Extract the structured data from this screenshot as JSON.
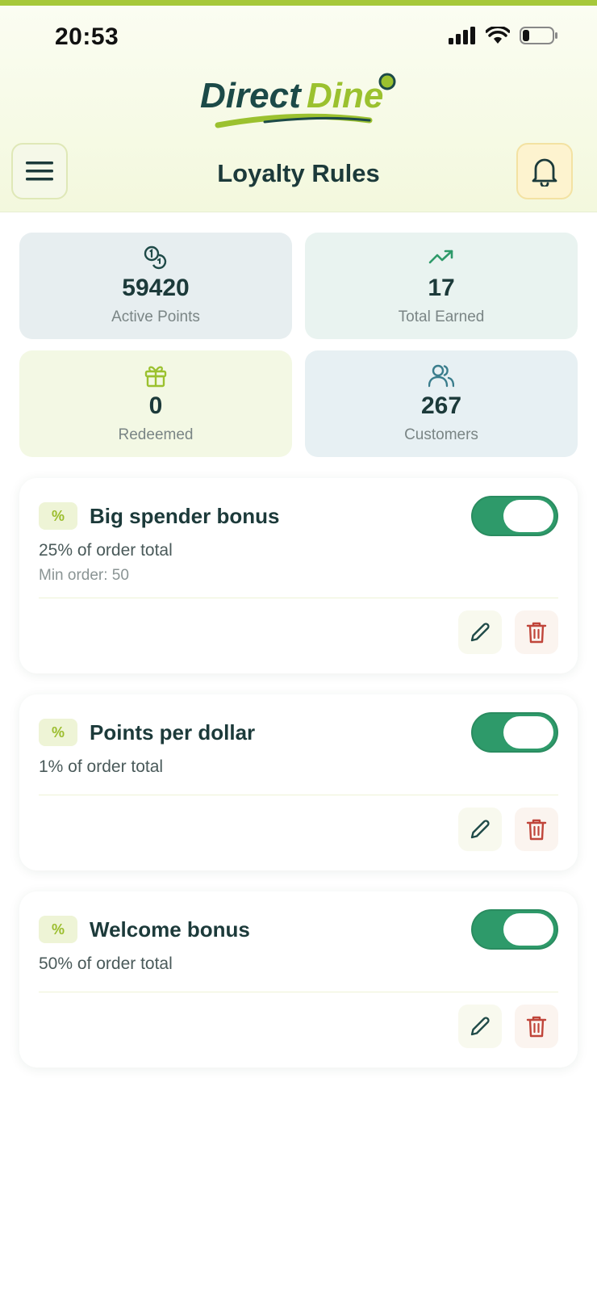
{
  "status_bar": {
    "time": "20:53"
  },
  "header": {
    "logo_text_part1": "Direct",
    "logo_text_part2": "Dine",
    "title": "Loyalty Rules"
  },
  "stats": [
    {
      "value": "59420",
      "label": "Active Points",
      "icon": "coins-icon",
      "bg": "#e7eef0"
    },
    {
      "value": "17",
      "label": "Total Earned",
      "icon": "trending-up-icon",
      "bg": "#e9f3f0"
    },
    {
      "value": "0",
      "label": "Redeemed",
      "icon": "gift-icon",
      "bg": "#f3f8e4"
    },
    {
      "value": "267",
      "label": "Customers",
      "icon": "users-icon",
      "bg": "#e7f0f3"
    }
  ],
  "rules": [
    {
      "badge": "%",
      "name": "Big spender bonus",
      "desc": "25% of order total",
      "min": "Min order: 50",
      "enabled": true
    },
    {
      "badge": "%",
      "name": "Points per dollar",
      "desc": "1% of order total",
      "enabled": true
    },
    {
      "badge": "%",
      "name": "Welcome bonus",
      "desc": "50% of order total",
      "enabled": true
    }
  ],
  "colors": {
    "accent_green": "#2e9a6a",
    "lime": "#a6c83a",
    "dark_teal": "#1c3a3a",
    "delete_red": "#c0453a"
  }
}
